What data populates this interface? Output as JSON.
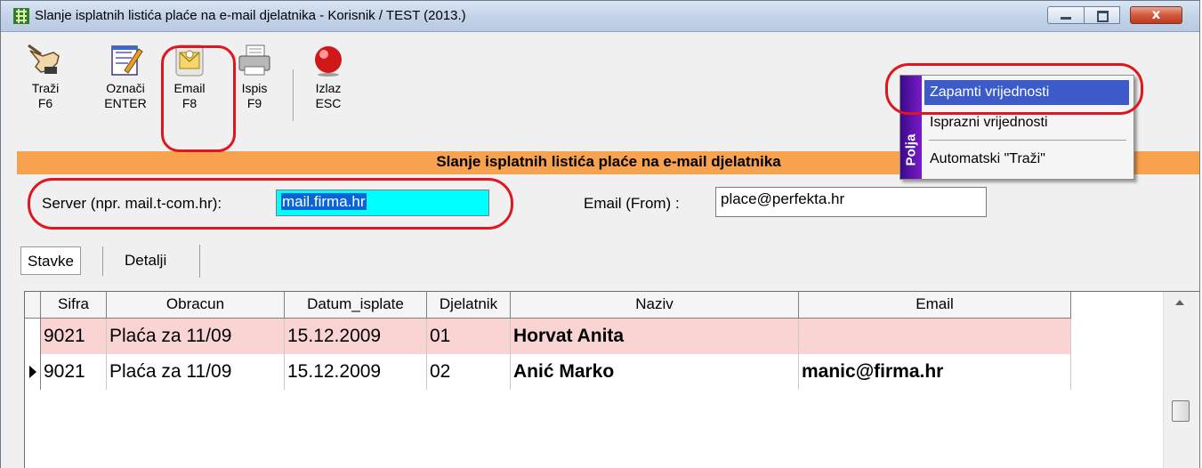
{
  "window": {
    "title": "Slanje isplatnih listića plaće na e-mail djelatnika - Korisnik / TEST (2013.)",
    "close_label": "x"
  },
  "toolbar": {
    "buttons": [
      {
        "label": "Traži",
        "key": "F6",
        "icon": "pointing-hand-icon"
      },
      {
        "label": "Označi",
        "key": "ENTER",
        "icon": "notepad-pencil-icon"
      },
      {
        "label": "Email",
        "key": "F8",
        "icon": "envelope-icon"
      },
      {
        "label": "Ispis",
        "key": "F9",
        "icon": "printer-icon"
      },
      {
        "label": "Izlaz",
        "key": "ESC",
        "icon": "red-ball-icon"
      }
    ]
  },
  "section_title": "Slanje isplatnih listića plaće na e-mail djelatnika",
  "form": {
    "server_label": "Server (npr. mail.t-com.hr):",
    "server_value": "mail.firma.hr",
    "email_from_label": "Email (From) :",
    "email_from_value": "place@perfekta.hr"
  },
  "tabs": [
    "Stavke",
    "Detalji"
  ],
  "grid": {
    "columns": [
      "Sifra",
      "Obracun",
      "Datum_isplate",
      "Djelatnik",
      "Naziv",
      "Email"
    ],
    "rows": [
      {
        "sifra": "9021",
        "obracun": "Plaća za 11/09",
        "datum": "15.12.2009",
        "djelatnik": "01",
        "naziv": "Horvat Anita",
        "email": ""
      },
      {
        "sifra": "9021",
        "obracun": "Plaća za 11/09",
        "datum": "15.12.2009",
        "djelatnik": "02",
        "naziv": "Anić Marko",
        "email": "manic@firma.hr"
      }
    ]
  },
  "context_menu": {
    "side_label": "Polja",
    "items": [
      "Zapamti vrijednosti",
      "Isprazni vrijednosti",
      "Automatski \"Traži\""
    ]
  },
  "colors": {
    "section_bar": "#f7a24f",
    "server_field": "#00ffff",
    "highlight_row": "#fad3d3",
    "annotation": "#e0161f",
    "menu_highlight": "#3c5ac8"
  }
}
